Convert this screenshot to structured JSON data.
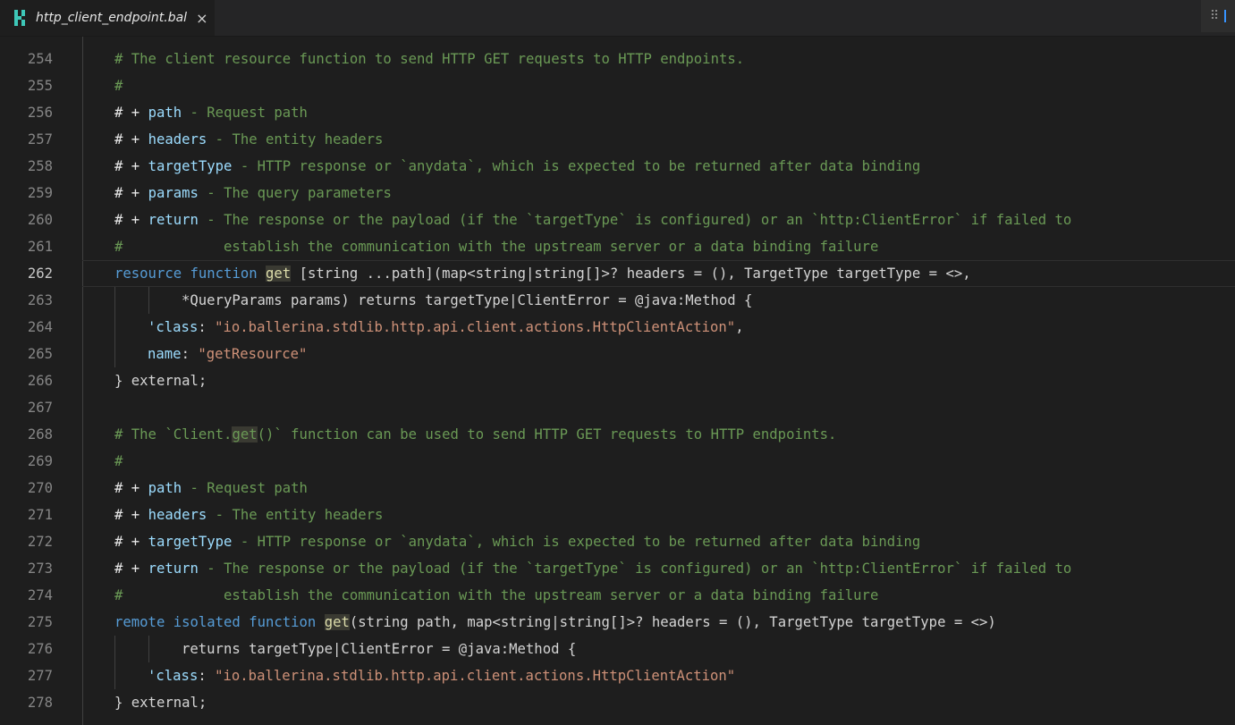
{
  "tab": {
    "filename": "http_client_endpoint.bal",
    "close_glyph": "×",
    "icon": "ballerina-file-icon"
  },
  "editor": {
    "first_line_number": 254,
    "lines": [
      "254",
      "255",
      "256",
      "257",
      "258",
      "259",
      "260",
      "261",
      "262",
      "263",
      "264",
      "265",
      "266",
      "267",
      "268",
      "269",
      "270",
      "271",
      "272",
      "273",
      "274",
      "275",
      "276",
      "277",
      "278"
    ],
    "current_line": 262
  },
  "code": {
    "l254": "# The client resource function to send HTTP GET requests to HTTP endpoints.",
    "l255": "#",
    "l256a": "# + ",
    "l256b": "path",
    "l256c": " - Request path",
    "l257a": "# + ",
    "l257b": "headers",
    "l257c": " - The entity headers",
    "l258a": "# + ",
    "l258b": "targetType",
    "l258c": " - HTTP response or `anydata`, which is expected to be returned after data binding",
    "l259a": "# + ",
    "l259b": "params",
    "l259c": " - The query parameters",
    "l260a": "# + ",
    "l260b": "return",
    "l260c": " - The response or the payload (if the `targetType` is configured) or an `http:ClientError` if failed to",
    "l261": "#            establish the communication with the upstream server or a data binding failure",
    "l262_resource": "resource",
    "l262_function": "function",
    "l262_get": "get",
    "l262_rest": "[string ...path](map<string|string[]>? headers = (), TargetType targetType = <>,",
    "l263": "*QueryParams params) returns targetType|ClientError = @java:Method {",
    "l264_key": "'class",
    "l264_val": "\"io.ballerina.stdlib.http.api.client.actions.HttpClientAction\"",
    "l265_key": "name",
    "l265_val": "\"getResource\"",
    "l266": "} external;",
    "l268a": "# The `Client.",
    "l268b": "get",
    "l268c": "()` function can be used to send HTTP GET requests to HTTP endpoints.",
    "l269": "#",
    "l270a": "# + ",
    "l270b": "path",
    "l270c": " - Request path",
    "l271a": "# + ",
    "l271b": "headers",
    "l271c": " - The entity headers",
    "l272a": "# + ",
    "l272b": "targetType",
    "l272c": " - HTTP response or `anydata`, which is expected to be returned after data binding",
    "l273a": "# + ",
    "l273b": "return",
    "l273c": " - The response or the payload (if the `targetType` is configured) or an `http:ClientError` if failed to",
    "l274": "#            establish the communication with the upstream server or a data binding failure",
    "l275_mods": "remote isolated function",
    "l275_get": "get",
    "l275_rest": "(string path, map<string|string[]>? headers = (), TargetType targetType = <>)",
    "l276": "returns targetType|ClientError = @java:Method {",
    "l277_key": "'class",
    "l277_val": "\"io.ballerina.stdlib.http.api.client.actions.HttpClientAction\"",
    "l278": "} external;"
  },
  "colors": {
    "comment": "#6a9955",
    "keyword": "#569cd6",
    "control": "#c586c0",
    "string": "#ce9178",
    "variable": "#9cdcfe",
    "function": "#dcdcaa"
  }
}
